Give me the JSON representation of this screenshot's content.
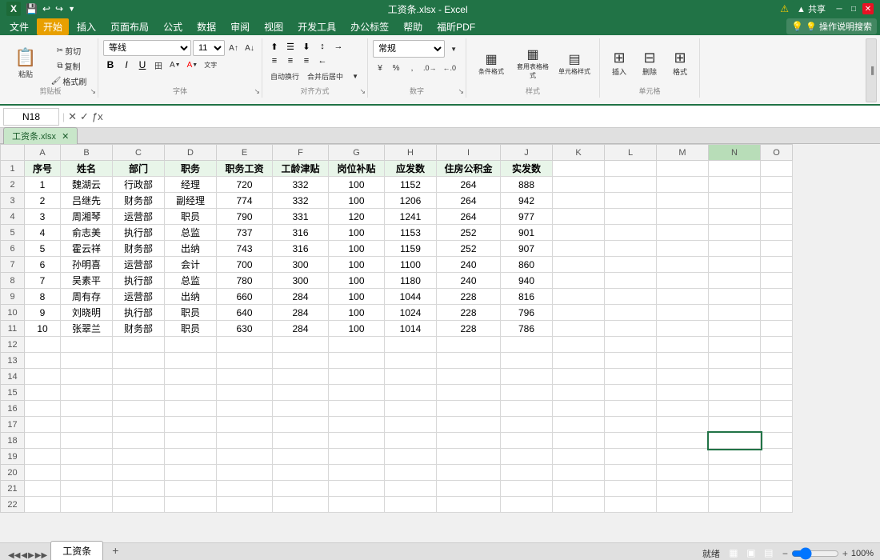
{
  "app": {
    "title": "工资条.xlsx - Excel",
    "filename": "工资条.xlsx"
  },
  "titlebar": {
    "save_icon": "💾",
    "undo_icon": "↩",
    "redo_icon": "↪",
    "title": "工资条.xlsx - Excel",
    "warning_icon": "⚠"
  },
  "menu": {
    "items": [
      "文件",
      "开始",
      "插入",
      "页面布局",
      "公式",
      "数据",
      "审阅",
      "视图",
      "开发工具",
      "办公标签",
      "帮助",
      "福昕PDF",
      "💡 操作说明搜索"
    ],
    "active": "开始"
  },
  "ribbon": {
    "clipboard_label": "剪贴板",
    "paste_label": "粘贴",
    "cut_label": "剪切",
    "copy_label": "复制",
    "format_painter_label": "格式刷",
    "font_label": "字体",
    "font_name": "等线",
    "font_size": "11",
    "bold": "B",
    "italic": "I",
    "underline": "U",
    "border_btn": "田",
    "fill_btn": "A",
    "font_color_btn": "A",
    "alignment_label": "对齐方式",
    "align_top": "⬆",
    "align_middle": "☰",
    "align_bottom": "⬇",
    "align_left": "≡",
    "align_center": "≡",
    "align_right": "≡",
    "wrap_text": "自动换行",
    "merge_center": "合并后居中",
    "number_label": "数字",
    "number_format": "常规",
    "percent_btn": "%",
    "comma_btn": ",",
    "increase_decimal": "+.0",
    "decrease_decimal": "-.0",
    "styles_label": "样式",
    "conditional_format": "条件格式",
    "table_format": "套用表格格式",
    "cell_styles": "单元格样式",
    "cells_label": "单元格",
    "insert_btn": "插入",
    "delete_btn": "删除",
    "format_btn": "格式",
    "editing_label": ""
  },
  "formula_bar": {
    "cell_ref": "N18",
    "formula": ""
  },
  "grid": {
    "columns": [
      "A",
      "B",
      "C",
      "D",
      "E",
      "F",
      "G",
      "H",
      "I",
      "J",
      "K",
      "L",
      "M",
      "N",
      "O"
    ],
    "header_row": {
      "A": "序号",
      "B": "姓名",
      "C": "部门",
      "D": "职务",
      "E": "职务工资",
      "F": "工龄津贴",
      "G": "岗位补贴",
      "H": "应发数",
      "I": "住房公积金",
      "J": "实发数"
    },
    "rows": [
      {
        "num": "2",
        "A": "1",
        "B": "魏湖云",
        "C": "行政部",
        "D": "经理",
        "E": "720",
        "F": "332",
        "G": "100",
        "H": "1152",
        "I": "264",
        "J": "888"
      },
      {
        "num": "3",
        "A": "2",
        "B": "吕继先",
        "C": "财务部",
        "D": "副经理",
        "E": "774",
        "F": "332",
        "G": "100",
        "H": "1206",
        "I": "264",
        "J": "942"
      },
      {
        "num": "4",
        "A": "3",
        "B": "周湘琴",
        "C": "运营部",
        "D": "职员",
        "E": "790",
        "F": "331",
        "G": "120",
        "H": "1241",
        "I": "264",
        "J": "977"
      },
      {
        "num": "5",
        "A": "4",
        "B": "俞志美",
        "C": "执行部",
        "D": "总监",
        "E": "737",
        "F": "316",
        "G": "100",
        "H": "1153",
        "I": "252",
        "J": "901"
      },
      {
        "num": "6",
        "A": "5",
        "B": "霍云祥",
        "C": "财务部",
        "D": "出纳",
        "E": "743",
        "F": "316",
        "G": "100",
        "H": "1159",
        "I": "252",
        "J": "907"
      },
      {
        "num": "7",
        "A": "6",
        "B": "孙明喜",
        "C": "运营部",
        "D": "会计",
        "E": "700",
        "F": "300",
        "G": "100",
        "H": "1100",
        "I": "240",
        "J": "860"
      },
      {
        "num": "8",
        "A": "7",
        "B": "吴素平",
        "C": "执行部",
        "D": "总监",
        "E": "780",
        "F": "300",
        "G": "100",
        "H": "1180",
        "I": "240",
        "J": "940"
      },
      {
        "num": "9",
        "A": "8",
        "B": "周有存",
        "C": "运营部",
        "D": "出纳",
        "E": "660",
        "F": "284",
        "G": "100",
        "H": "1044",
        "I": "228",
        "J": "816"
      },
      {
        "num": "10",
        "A": "9",
        "B": "刘晓明",
        "C": "执行部",
        "D": "职员",
        "E": "640",
        "F": "284",
        "G": "100",
        "H": "1024",
        "I": "228",
        "J": "796"
      },
      {
        "num": "11",
        "A": "10",
        "B": "张翠兰",
        "C": "财务部",
        "D": "职员",
        "E": "630",
        "F": "284",
        "G": "100",
        "H": "1014",
        "I": "228",
        "J": "786"
      }
    ],
    "empty_rows": [
      "12",
      "13",
      "14",
      "15",
      "16",
      "17",
      "18",
      "19",
      "20",
      "21",
      "22"
    ],
    "selected_cell": "N18"
  },
  "sheets": {
    "tabs": [
      "工资条"
    ],
    "active": "工资条",
    "add_label": "+"
  },
  "status_bar": {
    "ready": "就绪",
    "view_normal": "▦",
    "view_layout": "▣",
    "view_page": "▤",
    "zoom": "100%",
    "zoom_slider": 100
  }
}
